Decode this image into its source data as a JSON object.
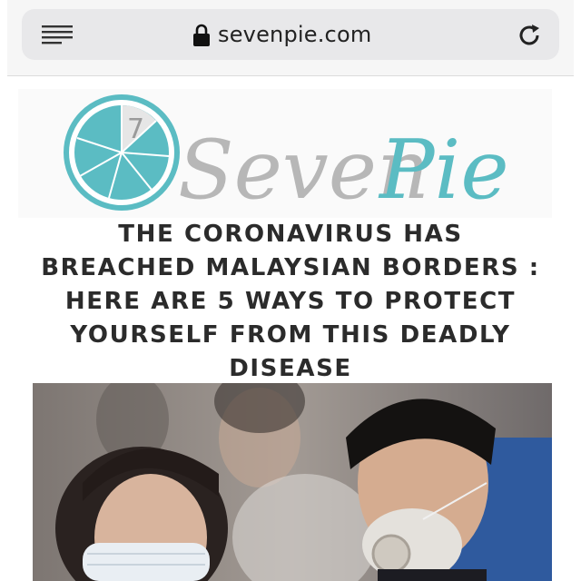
{
  "browser": {
    "url": "sevenpie.com",
    "icons": {
      "menu": "hamburger-menu-icon",
      "lock": "lock-icon",
      "reload": "reload-icon"
    }
  },
  "logo": {
    "badge_number": "7",
    "wordmark_part1": "Seven",
    "wordmark_part2": "Pie",
    "colors": {
      "teal": "#5bbcc3",
      "grey": "#b7b7b7"
    }
  },
  "article": {
    "headline_lines": [
      "THE CORONAVIRUS HAS",
      "BREACHED MALAYSIAN BORDERS :",
      "HERE ARE 5 WAYS TO PROTECT",
      "YOURSELF FROM THIS DEADLY",
      "DISEASE"
    ]
  }
}
